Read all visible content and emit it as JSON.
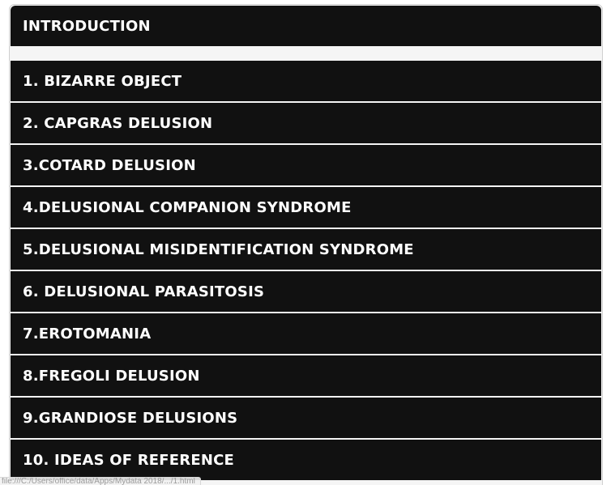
{
  "header": {
    "title": "INTRODUCTION"
  },
  "items": [
    {
      "label": "1. BIZARRE OBJECT"
    },
    {
      "label": "2. CAPGRAS DELUSION"
    },
    {
      "label": "3.COTARD DELUSION"
    },
    {
      "label": "4.DELUSIONAL COMPANION SYNDROME"
    },
    {
      "label": "5.DELUSIONAL MISIDENTIFICATION SYNDROME"
    },
    {
      "label": "6. DELUSIONAL PARASITOSIS"
    },
    {
      "label": "7.EROTOMANIA"
    },
    {
      "label": "8.FREGOLI DELUSION"
    },
    {
      "label": "9.GRANDIOSE DELUSIONS"
    },
    {
      "label": "10. IDEAS OF REFERENCE"
    }
  ],
  "status_bar": {
    "url": "file:///C:/Users/office/data/Apps/Mydata 2018/.../1.html"
  },
  "colors": {
    "row_background": "#111111",
    "text": "#ffffff",
    "panel_background": "#f5f5f5"
  }
}
